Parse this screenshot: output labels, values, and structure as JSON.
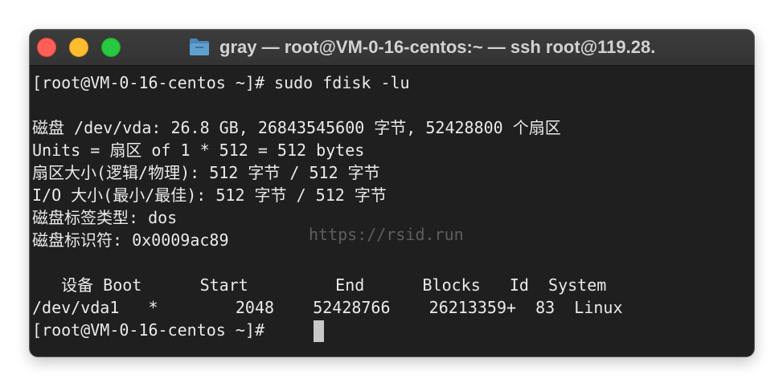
{
  "window": {
    "title": "gray — root@VM-0-16-centos:~ — ssh root@119.28.",
    "folder_icon": "folder-icon",
    "colors": {
      "close": "#ff5f57",
      "minimize": "#febc2e",
      "maximize": "#28c840",
      "terminal_bg": "#1f1f1f",
      "text": "#eaeaea"
    }
  },
  "terminal": {
    "lines": [
      "[root@VM-0-16-centos ~]# sudo fdisk -lu",
      "",
      "磁盘 /dev/vda: 26.8 GB, 26843545600 字节, 52428800 个扇区",
      "Units = 扇区 of 1 * 512 = 512 bytes",
      "扇区大小(逻辑/物理): 512 字节 / 512 字节",
      "I/O 大小(最小/最佳): 512 字节 / 512 字节",
      "磁盘标签类型: dos",
      "磁盘标识符: 0x0009ac89",
      "",
      "   设备 Boot      Start         End      Blocks   Id  System",
      "/dev/vda1   *        2048    52428766    26213359+  83  Linux",
      "[root@VM-0-16-centos ~]# "
    ],
    "watermark": "https://rsid.run"
  }
}
